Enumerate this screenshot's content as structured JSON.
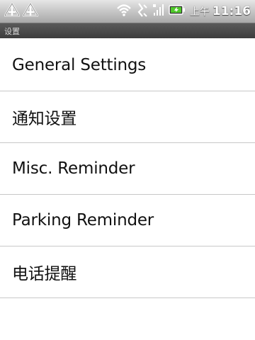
{
  "status_bar": {
    "left_icons": [
      "notification-icon",
      "notification-icon"
    ],
    "right_icons": [
      "wifi-icon",
      "data-transfer-icon",
      "signal-icon",
      "battery-charging-icon"
    ],
    "ampm": "上午",
    "time": "11:16",
    "battery_color": "#4fc92a"
  },
  "title_bar": {
    "title": "设置"
  },
  "settings_list": {
    "items": [
      {
        "label": "General Settings"
      },
      {
        "label": "通知设置"
      },
      {
        "label": "Misc. Reminder"
      },
      {
        "label": "Parking Reminder"
      },
      {
        "label": "电话提醒"
      }
    ]
  }
}
